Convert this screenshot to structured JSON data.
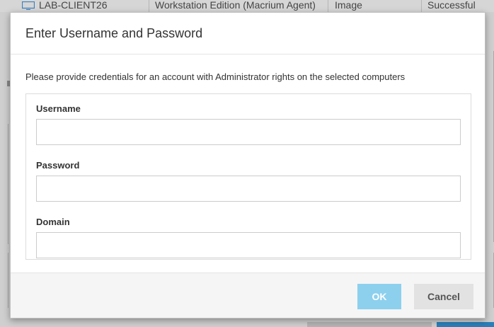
{
  "background": {
    "table_row": {
      "computer": "LAB-CLIENT26",
      "edition": "Workstation Edition (Macrium Agent)",
      "type": "Image",
      "status": "Successful"
    },
    "computer_icon": "monitor-icon"
  },
  "dialog": {
    "title": "Enter Username and Password",
    "instruction": "Please provide credentials for an account with Administrator rights on the selected computers",
    "fields": {
      "username": {
        "label": "Username",
        "value": "",
        "placeholder": ""
      },
      "password": {
        "label": "Password",
        "value": "",
        "placeholder": ""
      },
      "domain": {
        "label": "Domain",
        "value": "",
        "placeholder": ""
      }
    },
    "buttons": {
      "ok": "OK",
      "cancel": "Cancel"
    }
  },
  "colors": {
    "ok_button": "#8dd0ee",
    "cancel_button": "#e2e2e2",
    "overlay": "#c8c8c8",
    "accent_blue": "#2a7fb8"
  }
}
